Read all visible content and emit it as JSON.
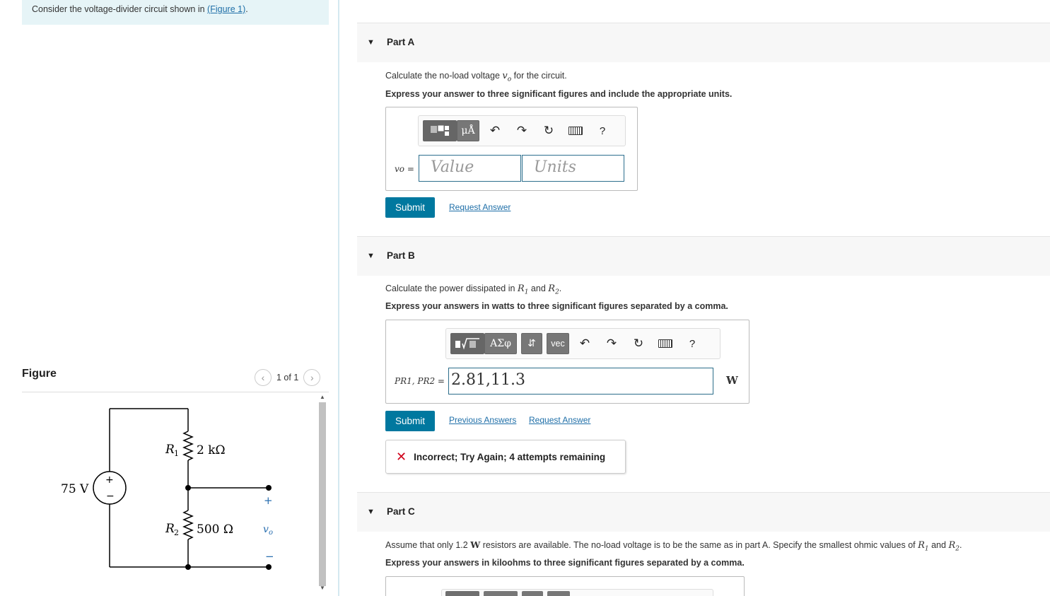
{
  "problem": {
    "text": "Consider the voltage-divider circuit shown in ",
    "figure_link": "(Figure 1)",
    "end": "."
  },
  "figure": {
    "label": "Figure",
    "pager": "1 of 1",
    "prev_icon": "chevron-left-icon",
    "next_icon": "chevron-right-icon",
    "source_voltage": "75 V",
    "r1_name": "R",
    "r1_sub": "1",
    "r1_value": "2 kΩ",
    "r2_name": "R",
    "r2_sub": "2",
    "r2_value": "500 Ω",
    "plus": "+",
    "output_label": "v",
    "output_sub": "o",
    "minus": "−"
  },
  "partA": {
    "title": "Part A",
    "question_pre": "Calculate the no-load voltage ",
    "question_var": "vo",
    "question_post": " for the circuit.",
    "instruction": "Express your answer to three significant figures and include the appropriate units.",
    "toolbar_unit_btn": "μÅ",
    "lhs": "vo =",
    "value_placeholder": "Value",
    "units_placeholder": "Units",
    "help": "?",
    "submit": "Submit",
    "request": "Request Answer"
  },
  "partB": {
    "title": "Part B",
    "question_pre": "Calculate the power dissipated in ",
    "question_r1": "R1",
    "question_and": " and ",
    "question_r2": "R2",
    "question_post": ".",
    "instruction": "Express your answers in watts to three significant figures separated by a comma.",
    "toolbar_sqrt": "√",
    "toolbar_greek": "ΑΣφ",
    "toolbar_arrows": "⇵",
    "toolbar_vec": "vec",
    "help": "?",
    "lhs": "PR1, PR2 =",
    "value": "2.81,11.3",
    "unit": "W",
    "submit": "Submit",
    "previous": "Previous Answers",
    "request": "Request Answer",
    "feedback": "Incorrect; Try Again; 4 attempts remaining"
  },
  "partC": {
    "title": "Part C",
    "question_pre": "Assume that only 1.2 ",
    "question_w": "W",
    "question_mid": " resistors are available. The no-load voltage is to be the same as in part A. Specify the smallest ohmic values of ",
    "question_r1": "R1",
    "question_and": " and ",
    "question_r2": "R2",
    "question_post": ".",
    "instruction": "Express your answers in kiloohms to three significant figures separated by a comma."
  }
}
